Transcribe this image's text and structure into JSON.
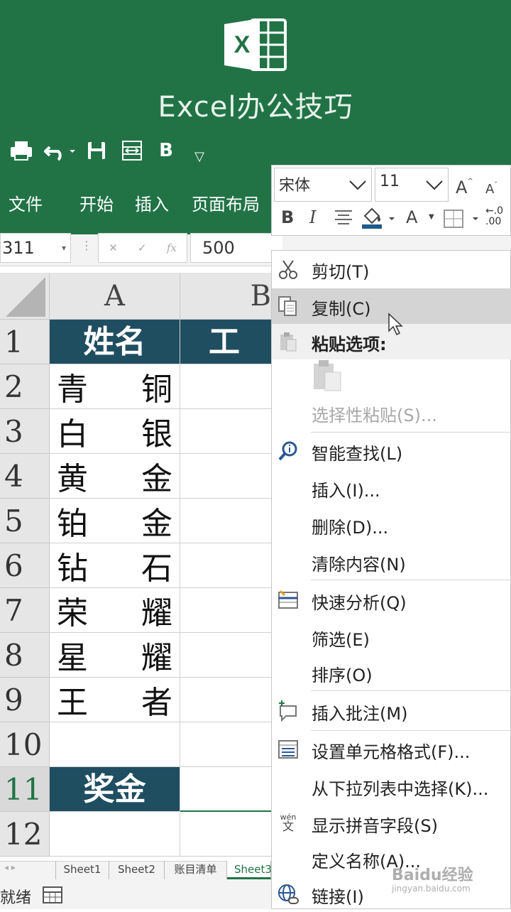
{
  "header": {
    "logo_letter": "X",
    "title": "Excel办公技巧",
    "quick_access": [
      "B"
    ]
  },
  "ribbon_tabs": [
    "文件",
    "开始",
    "插入",
    "页面布局"
  ],
  "formula_bar": {
    "name_box": "311",
    "value": "500"
  },
  "grid": {
    "col_headers": [
      "A",
      "B"
    ],
    "rows": [
      {
        "num": "1",
        "a": [
          "姓名"
        ],
        "b": "工"
      },
      {
        "num": "2",
        "a": [
          "青",
          "铜"
        ]
      },
      {
        "num": "3",
        "a": [
          "白",
          "银"
        ]
      },
      {
        "num": "4",
        "a": [
          "黄",
          "金"
        ]
      },
      {
        "num": "5",
        "a": [
          "铂",
          "金"
        ]
      },
      {
        "num": "6",
        "a": [
          "钻",
          "石"
        ]
      },
      {
        "num": "7",
        "a": [
          "荣",
          "耀"
        ]
      },
      {
        "num": "8",
        "a": [
          "星",
          "耀"
        ]
      },
      {
        "num": "9",
        "a": [
          "王",
          "者"
        ]
      },
      {
        "num": "10",
        "a": [
          ""
        ]
      },
      {
        "num": "11",
        "a": [
          "奖金"
        ]
      },
      {
        "num": "12",
        "a": [
          ""
        ]
      }
    ]
  },
  "sheet_tabs": [
    "Sheet1",
    "Sheet2",
    "账目清单",
    "Sheet3"
  ],
  "status": "就绪",
  "mini_toolbar": {
    "font_name": "宋体",
    "font_size": "11",
    "grow_font": "A",
    "shrink_font": "A",
    "bold": "B",
    "italic": "I",
    "font_color": "A",
    "decimal_top": "←.0",
    "decimal_bottom": ".00"
  },
  "context_menu": {
    "items": [
      {
        "label": "剪切(T)",
        "icon": "scissors-icon"
      },
      {
        "label": "复制(C)",
        "icon": "copy-icon"
      },
      {
        "label": "粘贴选项:",
        "icon": "paste-icon"
      },
      {
        "label": "选择性粘贴(S)...",
        "icon": ""
      },
      {
        "label": "智能查找(L)",
        "icon": "smart-lookup-icon"
      },
      {
        "label": "插入(I)...",
        "icon": ""
      },
      {
        "label": "删除(D)...",
        "icon": ""
      },
      {
        "label": "清除内容(N)",
        "icon": ""
      },
      {
        "label": "快速分析(Q)",
        "icon": "quick-analysis-icon"
      },
      {
        "label": "筛选(E)",
        "icon": ""
      },
      {
        "label": "排序(O)",
        "icon": ""
      },
      {
        "label": "插入批注(M)",
        "icon": "comment-icon"
      },
      {
        "label": "设置单元格格式(F)...",
        "icon": "format-cells-icon"
      },
      {
        "label": "从下拉列表中选择(K)...",
        "icon": ""
      },
      {
        "label": "显示拼音字段(S)",
        "icon": "phonetic-icon"
      },
      {
        "label": "定义名称(A)...",
        "icon": ""
      },
      {
        "label": "链接(I)",
        "icon": "link-icon"
      }
    ],
    "phonetic_icon_top": "wén",
    "phonetic_icon_bottom": "文"
  },
  "watermark": {
    "brand": "Baidu经验",
    "url": "jingyan.baidu.com"
  },
  "colors": {
    "excel_green": "#217346",
    "header_cell": "#1f4e61",
    "menu_highlight": "#d4d4d4"
  }
}
